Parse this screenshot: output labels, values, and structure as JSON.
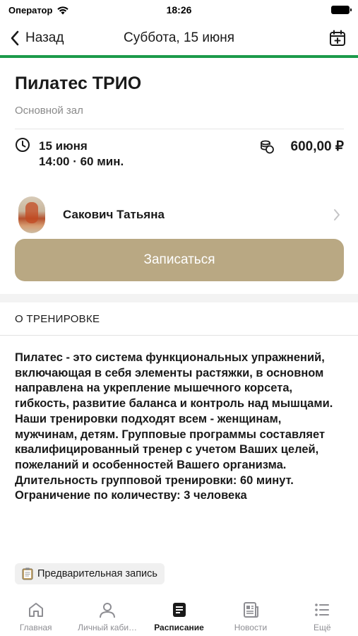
{
  "status_bar": {
    "carrier": "Оператор",
    "time": "18:26"
  },
  "nav": {
    "back_label": "Назад",
    "title": "Суббота, 15 июня"
  },
  "class": {
    "title": "Пилатес ТРИО",
    "hall": "Основной зал",
    "date": "15 июня",
    "time_duration": "14:00 · 60 мин.",
    "price": "600,00 ₽"
  },
  "trainer": {
    "name": "Сакович Татьяна"
  },
  "signup_button": "Записаться",
  "about": {
    "heading": "О ТРЕНИРОВКЕ",
    "text": "Пилатес - это система функциональных упражнений, включающая в себя элементы растяжки, в основном направлена на укрепление мышечного корсета, гибкость, развитие баланса и контроль над мышцами. Наши тренировки подходят всем - женщинам, мужчинам, детям. Групповые программы составляет квалифицированный тренер с учетом Ваших целей, пожеланий и особенностей Вашего организма.\nДлительность групповой тренировки: 60 минут.\nОграничение по количеству: 3 человека"
  },
  "tag": {
    "label": "Предварительная запись",
    "icon": "clipboard-icon"
  },
  "tabs": [
    {
      "label": "Главная",
      "icon": "home-icon"
    },
    {
      "label": "Личный каби…",
      "icon": "profile-icon"
    },
    {
      "label": "Расписание",
      "icon": "schedule-icon",
      "active": true
    },
    {
      "label": "Новости",
      "icon": "news-icon"
    },
    {
      "label": "Ещё",
      "icon": "more-icon"
    }
  ],
  "colors": {
    "accent_green": "#1c9a4a",
    "button_gold": "#b9a883"
  }
}
